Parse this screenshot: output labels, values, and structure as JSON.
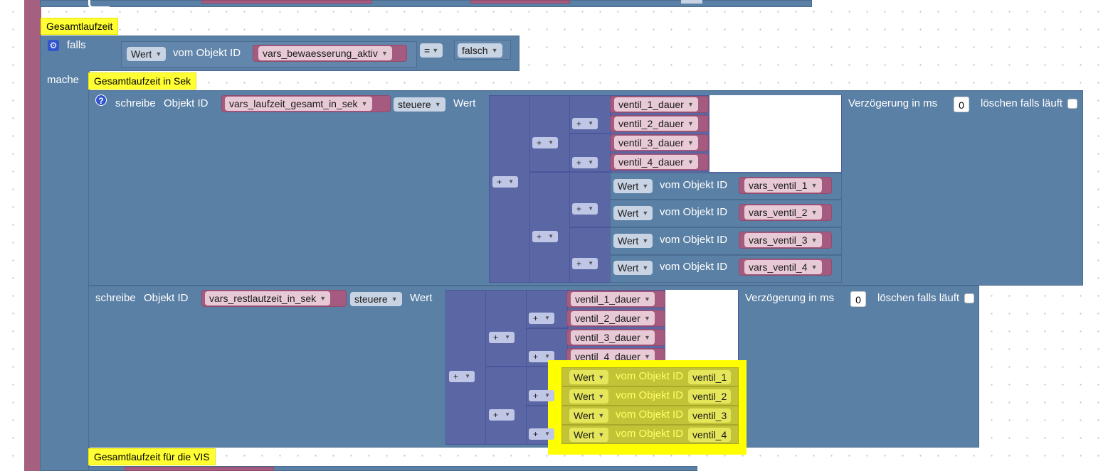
{
  "comments": {
    "gesamtlaufzeit": "Gesamtlaufzeit",
    "gesamtlaufzeit_sek": "Gesamtlaufzeit in Sek",
    "gesamtlaufzeit_vis": "Gesamtlaufzeit für die VIS"
  },
  "if_block": {
    "falls_label": "falls",
    "mache_label": "mache",
    "value_dropdown": "Wert",
    "vom_objekt_id": "vom Objekt ID",
    "object_id": "vars_bewaesserung_aktiv",
    "operator": "=",
    "compare_value": "falsch"
  },
  "write_block_1": {
    "schreibe": "schreibe",
    "objekt_id_label": "Objekt ID",
    "object_id": "vars_laufzeit_gesamt_in_sek",
    "mode": "steuere",
    "wert_label": "Wert",
    "delay_label": "Verzögerung in ms",
    "delay_value": "0",
    "clear_label": "löschen falls läuft",
    "plus_op": "+",
    "vars": [
      "ventil_1_dauer",
      "ventil_2_dauer",
      "ventil_3_dauer",
      "ventil_4_dauer"
    ],
    "value_rows": [
      {
        "wert": "Wert",
        "vom": "vom Objekt ID",
        "id": "vars_ventil_1"
      },
      {
        "wert": "Wert",
        "vom": "vom Objekt ID",
        "id": "vars_ventil_2"
      },
      {
        "wert": "Wert",
        "vom": "vom Objekt ID",
        "id": "vars_ventil_3"
      },
      {
        "wert": "Wert",
        "vom": "vom Objekt ID",
        "id": "vars_ventil_4"
      }
    ]
  },
  "write_block_2": {
    "schreibe": "schreibe",
    "objekt_id_label": "Objekt ID",
    "object_id": "vars_restlautzeit_in_sek",
    "mode": "steuere",
    "wert_label": "Wert",
    "delay_label": "Verzögerung in ms",
    "delay_value": "0",
    "clear_label": "löschen falls läuft",
    "plus_op": "+",
    "vars": [
      "ventil_1_dauer",
      "ventil_2_dauer",
      "ventil_3_dauer",
      "ventil_4_dauer"
    ],
    "value_rows": [
      {
        "wert": "Wert",
        "vom": "vom Objekt ID",
        "id": "ventil_1"
      },
      {
        "wert": "Wert",
        "vom": "vom Objekt ID",
        "id": "ventil_2"
      },
      {
        "wert": "Wert",
        "vom": "vom Objekt ID",
        "id": "ventil_3"
      },
      {
        "wert": "Wert",
        "vom": "vom Objekt ID",
        "id": "ventil_4"
      }
    ]
  },
  "colors": {
    "event_block": "#a5607f",
    "logic_block": "#5b80a5",
    "math_block": "#5b67a5",
    "variable_block": "#a55b80",
    "highlight": "#ffff00",
    "comment": "#ffff33"
  }
}
